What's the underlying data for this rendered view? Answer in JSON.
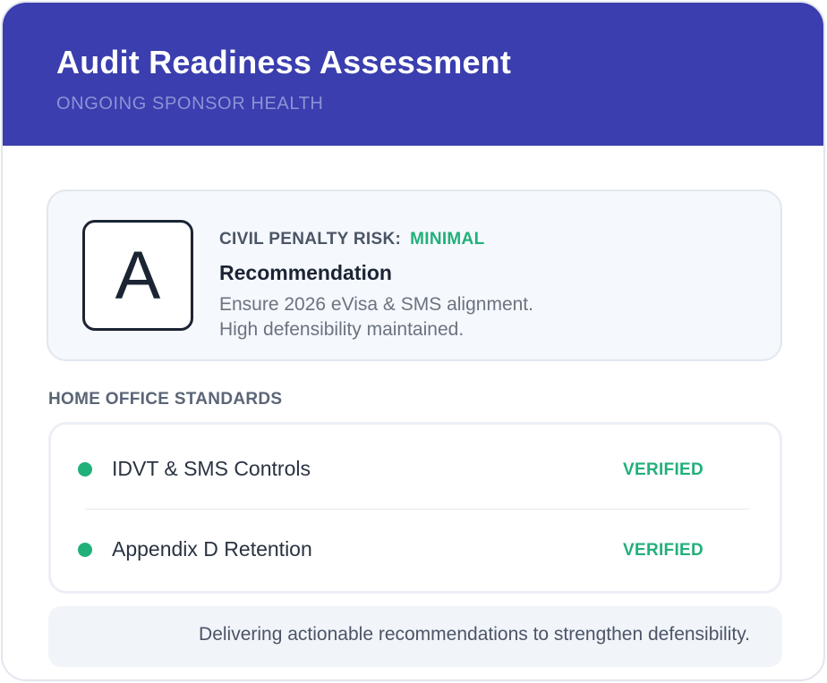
{
  "header": {
    "title": "Audit Readiness Assessment",
    "subtitle": "ONGOING SPONSOR HEALTH"
  },
  "grade": {
    "letter": "A",
    "risk_label": "CIVIL PENALTY RISK:",
    "risk_value": "MINIMAL",
    "recommendation_title": "Recommendation",
    "recommendation_lines": [
      "Ensure 2026 eVisa & SMS alignment.",
      "High defensibility maintained."
    ]
  },
  "standards": {
    "section_label": "HOME OFFICE STANDARDS",
    "items": [
      {
        "label": "IDVT & SMS Controls",
        "status": "VERIFIED"
      },
      {
        "label": "Appendix D Retention",
        "status": "VERIFIED"
      }
    ]
  },
  "footer": {
    "note": "Delivering actionable recommendations to strengthen defensibility."
  },
  "colors": {
    "header_bg": "#3a3eae",
    "accent_green": "#21b07a",
    "text_dark": "#1b2433"
  }
}
